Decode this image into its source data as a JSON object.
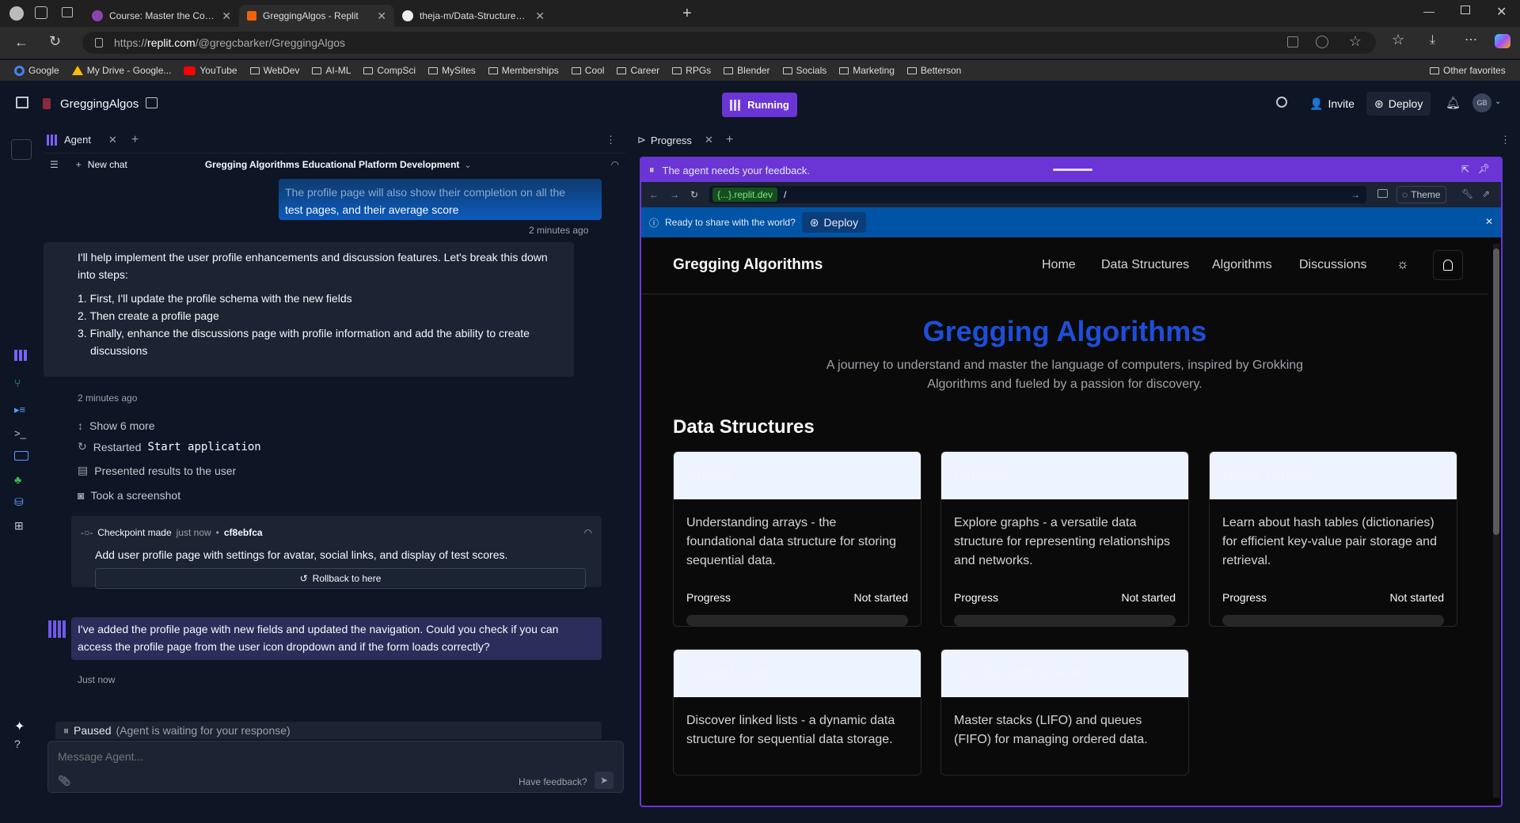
{
  "browser": {
    "tabs": [
      {
        "title": "Course: Master the Coding Interv",
        "active": false
      },
      {
        "title": "GreggingAlgos - Replit",
        "active": true
      },
      {
        "title": "theja-m/Data-Structures-and-Alg",
        "active": false
      }
    ],
    "url_prefix": "https://",
    "url_host": "replit.com",
    "url_path": "/@gregcbarker/GreggingAlgos",
    "favorites": [
      "Google",
      "My Drive - Google...",
      "YouTube",
      "WebDev",
      "AI-ML",
      "CompSci",
      "MySites",
      "Memberships",
      "Cool",
      "Career",
      "RPGs",
      "Blender",
      "Socials",
      "Marketing",
      "Betterson"
    ],
    "other_favorites": "Other favorites"
  },
  "replit": {
    "project_name": "GreggingAlgos",
    "run_status": "Running",
    "invite_label": "Invite",
    "deploy_label": "Deploy",
    "avatar_initials": "GB",
    "accent": "#6b35d6"
  },
  "agent": {
    "tab_label": "Agent",
    "new_chat_label": "New chat",
    "chat_title": "Gregging Algorithms Educational Platform Development",
    "user_msg_tail_1": "The profile page will also show their completion on all the",
    "user_msg_tail_2": "test pages, and their average score",
    "user_msg_time": "2 minutes ago",
    "agent_msg1_intro": "I'll help implement the user profile enhancements and discussion features. Let's break this down into steps:",
    "agent_msg1_step1": "1. First, I'll update the profile schema with the new fields",
    "agent_msg1_step2": "2. Then create a profile page",
    "agent_msg1_step3": "3. Finally, enhance the discussions page with profile information and add the ability to create discussions",
    "agent_msg1_time": "2 minutes ago",
    "show_more": "Show 6 more",
    "restarted_prefix": "Restarted",
    "restarted_code": "Start application",
    "presented": "Presented results to the user",
    "screenshot": "Took a screenshot",
    "checkpoint_label": "Checkpoint made",
    "checkpoint_time": "just now",
    "checkpoint_hash": "cf8ebfca",
    "checkpoint_desc": "Add user profile page with settings for avatar, social links, and display of test scores.",
    "rollback_label": "Rollback to here",
    "agent_msg2": "I've added the profile page with new fields and updated the navigation. Could you check if you can access the profile page from the user icon dropdown and if the form loads correctly?",
    "agent_msg2_time": "Just now",
    "paused_label": "Paused",
    "paused_detail": "(Agent is waiting for your response)",
    "message_placeholder": "Message Agent...",
    "feedback_label": "Have feedback?"
  },
  "progress_panel": {
    "tab_label": "Progress",
    "feedback_banner": "The agent needs your feedback.",
    "dev_domain": "{...}.replit.dev",
    "path": "/",
    "theme_label": "Theme",
    "ready_text": "Ready to share with the world?",
    "deploy_label": "Deploy"
  },
  "site": {
    "brand": "Gregging Algorithms",
    "nav": [
      "Home",
      "Data Structures",
      "Algorithms",
      "Discussions"
    ],
    "hero_title": "Gregging Algorithms",
    "hero_subtitle_1": "A journey to understand and master the language of computers, inspired by Grokking",
    "hero_subtitle_2": "Algorithms and fueled by a passion for discovery.",
    "section_title": "Data Structures",
    "progress_label": "Progress",
    "cards": [
      {
        "title": "Arrays",
        "desc": "Understanding arrays - the foundational data structure for storing sequential data.",
        "status": "Not started"
      },
      {
        "title": "Graphs",
        "desc": "Explore graphs - a versatile data structure for representing relationships and networks.",
        "status": "Not started"
      },
      {
        "title": "Hash Tables",
        "desc": "Learn about hash tables (dictionaries) for efficient key-value pair storage and retrieval.",
        "status": "Not started"
      },
      {
        "title": "Linked Lists",
        "desc": "Discover linked lists - a dynamic data structure for sequential data storage.",
        "status": ""
      },
      {
        "title": "Stacks and Queues",
        "desc": "Master stacks (LIFO) and queues (FIFO) for managing ordered data.",
        "status": ""
      }
    ],
    "hero_color": "#1d4ed8"
  }
}
